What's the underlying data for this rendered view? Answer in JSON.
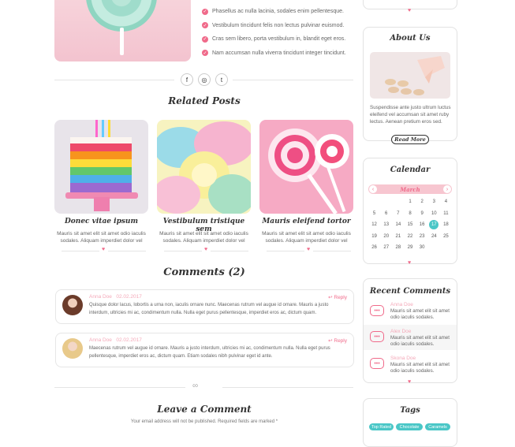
{
  "features": [
    "Phasellus ac nulla lacinia, sodales enim pellentesque.",
    "Vestibulum tincidunt felis non lectus pulvinar euismod.",
    "Cras sem libero, porta vestibulum in, blandit eget eros.",
    "Nam accumsan nulla viverra tincidunt integer tincidunt."
  ],
  "social": {
    "facebook": "f",
    "instagram": "◎",
    "twitter": "t"
  },
  "related": {
    "title": "Related Posts",
    "posts": [
      {
        "title": "Donec vitae ipsum",
        "excerpt": "Mauris sit amet elit sit amet odio iaculis sodales. Aliquam imperdiet dolor vel"
      },
      {
        "title": "Vestibulum tristique sem",
        "excerpt": "Mauris sit amet elit sit amet odio iaculis sodales. Aliquam imperdiet dolor vel"
      },
      {
        "title": "Mauris eleifend tortor",
        "excerpt": "Mauris sit amet elit sit amet odio iaculis sodales. Aliquam imperdiet dolor vel"
      }
    ]
  },
  "comments": {
    "title": "Comments (2)",
    "items": [
      {
        "author": "Anna Doe",
        "date": "02.02.2017",
        "reply": "Reply",
        "text": "Quisque dolor lacus, lobortis a urna non, iaculis ornare nunc. Maecenas rutrum vel augue id ornare. Mauris a justo interdum, ultricies mi ac, condimentum nulla. Nulla eget purus pellentesque, imperdiet eros ac, dictum quam."
      },
      {
        "author": "Anna Doe",
        "date": "02.02.2017",
        "reply": "Reply",
        "text": "Maecenas rutrum vel augue id ornare. Mauris a justo interdum, ultricies mi ac, condimentum nulla. Nulla eget purus pellentesque, imperdiet eros ac, dictum quam. Etiam sodales nibh pulvinar eget id ante."
      }
    ]
  },
  "leave": {
    "title": "Leave a Comment",
    "note": "Your email address will not be published. Required fields are marked *"
  },
  "sidebar": {
    "about": {
      "title": "About Us",
      "text": "Suspendisse ante justo ultrum luctus eleifend vel accumsan sit amet ruby lectus. Aenean pretium eros sed.",
      "button": "Read More"
    },
    "calendar": {
      "title": "Calendar",
      "month": "March",
      "prev": "‹",
      "next": "›",
      "weeks": [
        [
          "",
          "",
          "",
          "1",
          "2",
          "3",
          "4"
        ],
        [
          "5",
          "6",
          "7",
          "8",
          "9",
          "10",
          "11"
        ],
        [
          "12",
          "13",
          "14",
          "15",
          "16",
          "17",
          "18"
        ],
        [
          "19",
          "20",
          "21",
          "22",
          "23",
          "24",
          "25"
        ],
        [
          "26",
          "27",
          "28",
          "29",
          "30",
          "",
          ""
        ]
      ],
      "today": "17"
    },
    "recent": {
      "title": "Recent Comments",
      "items": [
        {
          "name": "Anna Doe",
          "text": "Mauris sit amet elit sit amet odio iaculis sodales."
        },
        {
          "name": "Alex Doe",
          "text": "Mauris sit amet elit sit amet odio iaculis sodales."
        },
        {
          "name": "Skona Doe",
          "text": "Mauris sit amet elit sit amet odio iaculis sodales."
        }
      ]
    },
    "tags": {
      "title": "Tags",
      "items": [
        "Top Rated",
        "Chocolate",
        "Caramels"
      ]
    }
  },
  "colors": {
    "accent": "#f06a8a",
    "teal": "#4ac7c7",
    "pink_light": "#f7c6d0"
  }
}
